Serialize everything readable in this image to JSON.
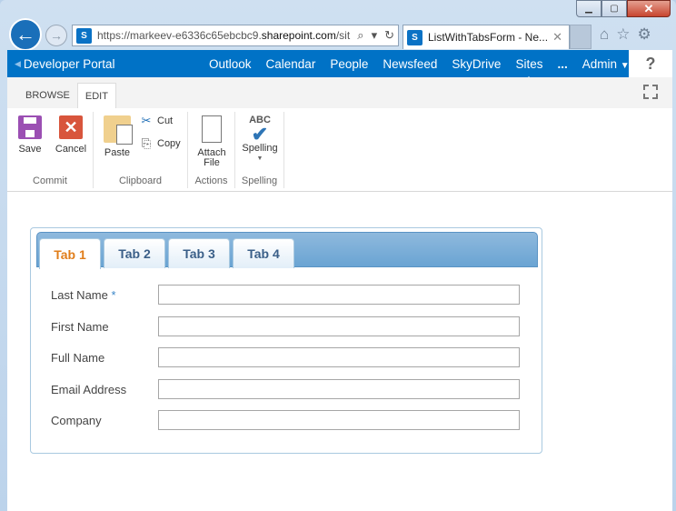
{
  "browser": {
    "url_prefix": "https://markeev-e6336c65ebcbc9.",
    "url_host": "sharepoint.com",
    "url_suffix": "/sit",
    "tab_title": "ListWithTabsForm - Ne...",
    "site_icon_label": "S",
    "icons": [
      "back-arrow-icon",
      "forward-arrow-icon",
      "search-icon",
      "refresh-icon",
      "home-icon",
      "star-icon",
      "gear-icon"
    ]
  },
  "suitebar": {
    "brand": "Developer Portal",
    "nav": [
      "Outlook",
      "Calendar",
      "People",
      "Newsfeed",
      "SkyDrive",
      "Sites",
      "..."
    ],
    "active": "Sites",
    "user": "Admin",
    "help": "?"
  },
  "ribbon": {
    "tabs": [
      "BROWSE",
      "EDIT"
    ],
    "selected_tab": "EDIT",
    "groups": {
      "commit": {
        "label": "Commit",
        "save": "Save",
        "cancel": "Cancel"
      },
      "clipboard": {
        "label": "Clipboard",
        "paste": "Paste",
        "cut": "Cut",
        "copy": "Copy"
      },
      "actions": {
        "label": "Actions",
        "attach_line1": "Attach",
        "attach_line2": "File"
      },
      "spelling": {
        "label": "Spelling",
        "button": "Spelling",
        "abc": "ABC"
      }
    }
  },
  "form": {
    "tabs": [
      "Tab 1",
      "Tab 2",
      "Tab 3",
      "Tab 4"
    ],
    "selected_tab": "Tab 1",
    "fields": [
      {
        "label": "Last Name",
        "required": true,
        "value": ""
      },
      {
        "label": "First Name",
        "required": false,
        "value": ""
      },
      {
        "label": "Full Name",
        "required": false,
        "value": ""
      },
      {
        "label": "Email Address",
        "required": false,
        "value": ""
      },
      {
        "label": "Company",
        "required": false,
        "value": ""
      }
    ],
    "required_marker": "*"
  },
  "colors": {
    "suitebar": "#0072c6",
    "selected_tab_text": "#e07d1a",
    "tab_text": "#3a5f88"
  }
}
